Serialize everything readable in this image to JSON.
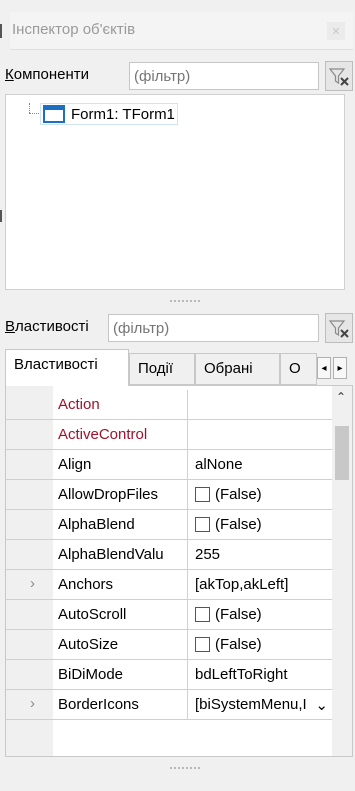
{
  "window": {
    "title": "Інспектор об'єктів"
  },
  "components": {
    "label_underlined": "К",
    "label_rest": "омпоненти",
    "filter_placeholder": "(фільтр)"
  },
  "tree": {
    "root_item": "Form1: TForm1"
  },
  "properties": {
    "label_underlined": "В",
    "label_rest": "ластивості",
    "filter_placeholder": "(фільтр)"
  },
  "tabs": [
    "Властивості",
    "Події",
    "Обрані",
    "О"
  ],
  "rows": [
    {
      "name": "Action",
      "value": "",
      "event": true,
      "checkbox": false,
      "expand": false
    },
    {
      "name": "ActiveControl",
      "value": "",
      "event": true,
      "checkbox": false,
      "expand": false
    },
    {
      "name": "Align",
      "value": "alNone",
      "event": false,
      "checkbox": false,
      "expand": false
    },
    {
      "name": "AllowDropFiles",
      "value": "(False)",
      "event": false,
      "checkbox": true,
      "expand": false
    },
    {
      "name": "AlphaBlend",
      "value": "(False)",
      "event": false,
      "checkbox": true,
      "expand": false
    },
    {
      "name": "AlphaBlendValu",
      "value": "255",
      "event": false,
      "checkbox": false,
      "expand": false
    },
    {
      "name": "Anchors",
      "value": "[akTop,akLeft]",
      "event": false,
      "checkbox": false,
      "expand": true
    },
    {
      "name": "AutoScroll",
      "value": "(False)",
      "event": false,
      "checkbox": true,
      "expand": false
    },
    {
      "name": "AutoSize",
      "value": "(False)",
      "event": false,
      "checkbox": true,
      "expand": false
    },
    {
      "name": "BiDiMode",
      "value": "bdLeftToRight",
      "event": false,
      "checkbox": false,
      "expand": false
    },
    {
      "name": "BorderIcons",
      "value": "[biSystemMenu,I",
      "event": false,
      "checkbox": false,
      "expand": true
    }
  ],
  "icons": {
    "close": "close-icon",
    "filter_clear": "filter-clear-icon",
    "expand": "chevron-right-icon",
    "scroll_up": "chevron-up-icon",
    "scroll_down": "chevron-down-icon"
  },
  "colors": {
    "event_name": "#a0122a",
    "tree_icon": "#1c6fc2"
  }
}
